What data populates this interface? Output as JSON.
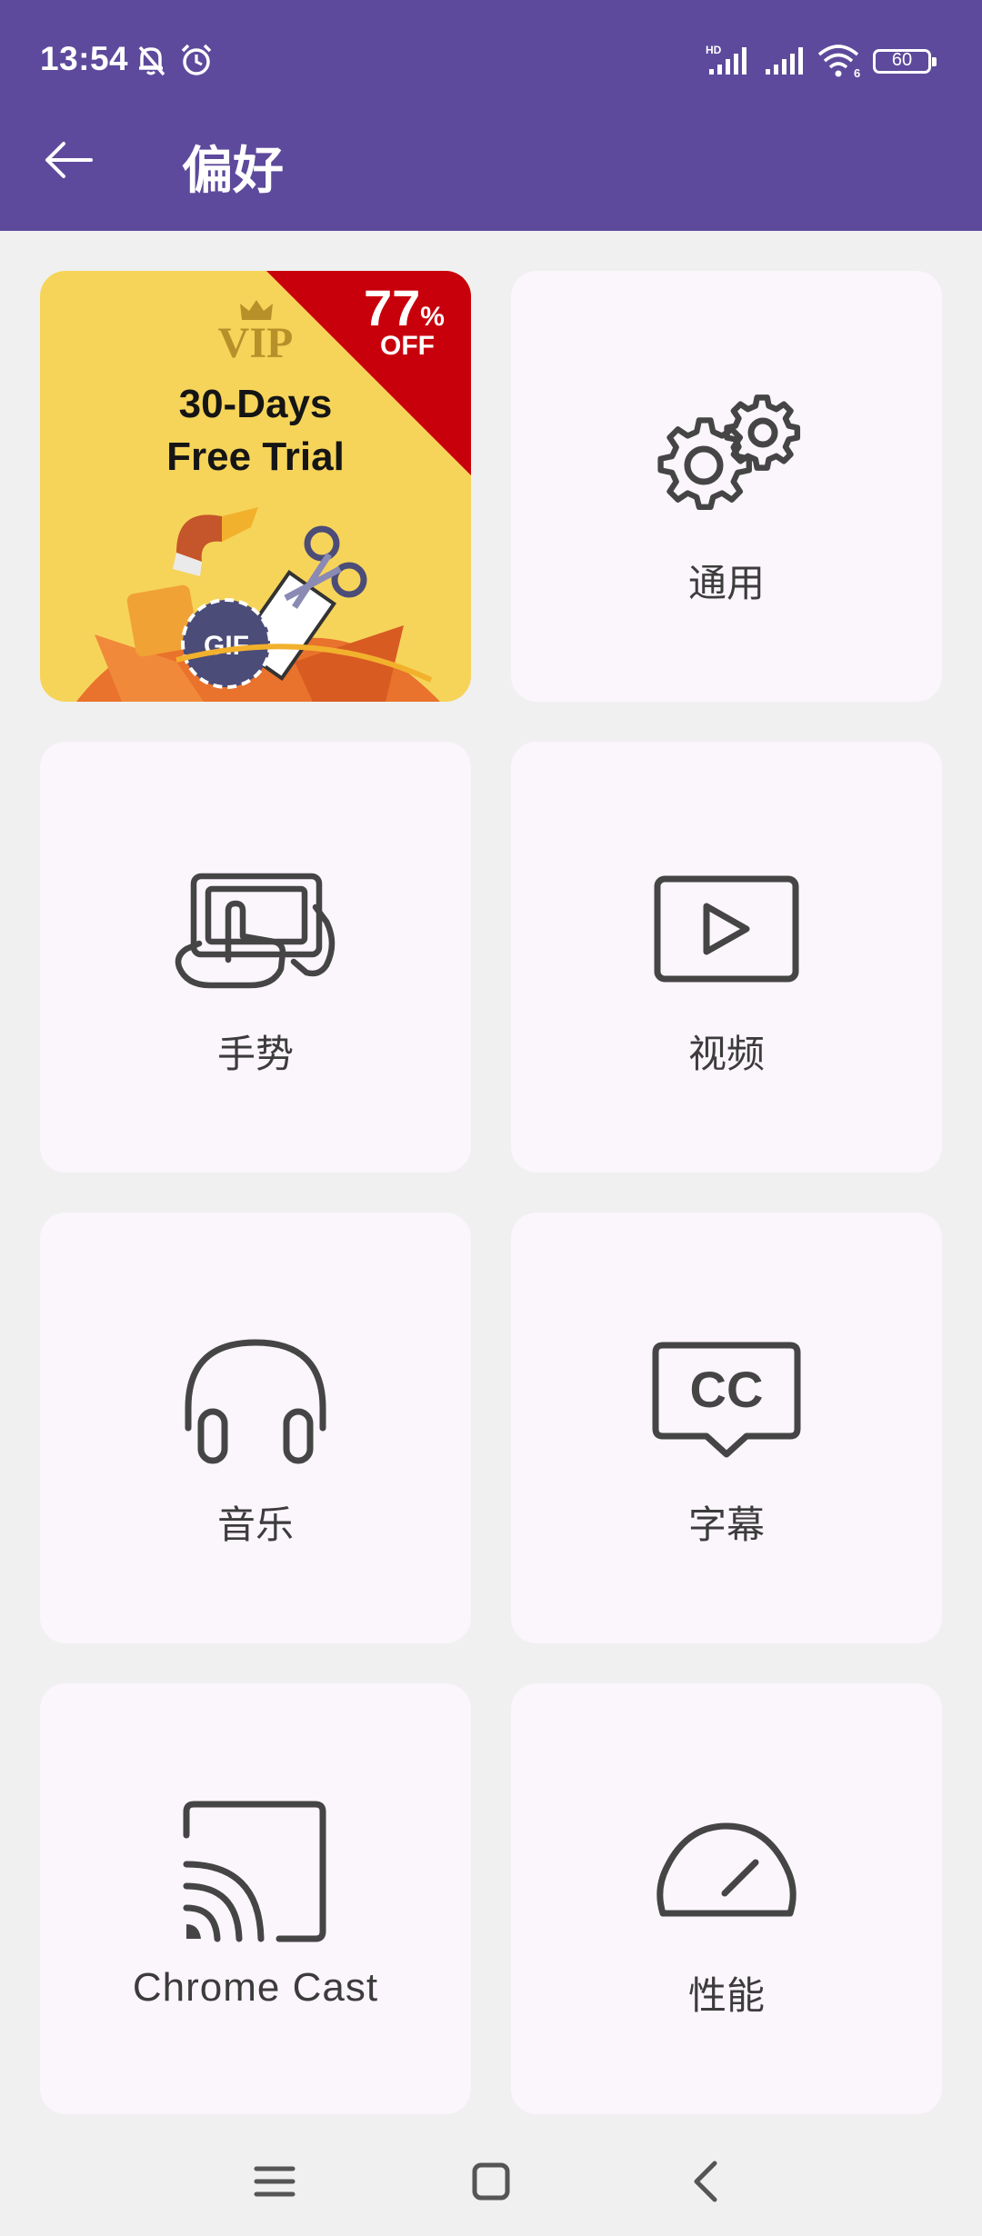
{
  "status_bar": {
    "time": "13:54",
    "icons": [
      "bell-off-icon",
      "alarm-icon",
      "hd-signal-icon",
      "signal-icon",
      "wifi-icon"
    ],
    "wifi_label": "6",
    "battery": "60"
  },
  "header": {
    "title": "偏好",
    "back_icon": "arrow-left-icon",
    "background": "#5d4a9c"
  },
  "promo": {
    "discount": "77",
    "percent": "%",
    "off": "OFF",
    "vip": "VIP",
    "line1": "30-Days",
    "line2": "Free Trial",
    "badge": "GIF",
    "colors": {
      "background": "#f6d45a",
      "corner": "#c8000c"
    }
  },
  "menu": {
    "general": {
      "label": "通用",
      "icon": "gears-icon"
    },
    "gesture": {
      "label": "手势",
      "icon": "gesture-tablet-icon"
    },
    "video": {
      "label": "视频",
      "icon": "video-play-icon"
    },
    "music": {
      "label": "音乐",
      "icon": "headphones-icon"
    },
    "subtitle": {
      "label": "字幕",
      "icon": "closed-caption-icon",
      "glyph": "CC"
    },
    "chromecast": {
      "label": "Chrome Cast",
      "icon": "cast-icon"
    },
    "performance": {
      "label": "性能",
      "icon": "speedometer-icon"
    }
  },
  "nav_bar": {
    "buttons": [
      "menu-icon",
      "home-icon",
      "back-icon"
    ]
  },
  "colors": {
    "card": "#fbf5fc",
    "page": "#f0f0f0",
    "icon": "#454545"
  }
}
